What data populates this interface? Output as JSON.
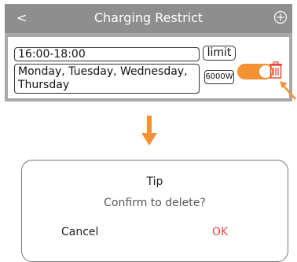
{
  "header": {
    "back_label": "<",
    "title": "Charging Restrict",
    "add_icon": "plus-circle-icon"
  },
  "rule": {
    "time_range": "16:00-18:00",
    "days": "Monday, Tuesday, Wednesday, Thursday",
    "mode": "limit",
    "power": "6000W",
    "enabled": true,
    "delete_icon": "trash-icon"
  },
  "annotations": {
    "pointer": "arrow-pointer-icon",
    "flow": "down-arrow-icon"
  },
  "dialog": {
    "title": "Tip",
    "message": "Confirm to delete?",
    "cancel_label": "Cancel",
    "ok_label": "OK"
  },
  "colors": {
    "header_bg": "#8e8e8e",
    "accent": "#f29233",
    "danger": "#e8483f"
  }
}
